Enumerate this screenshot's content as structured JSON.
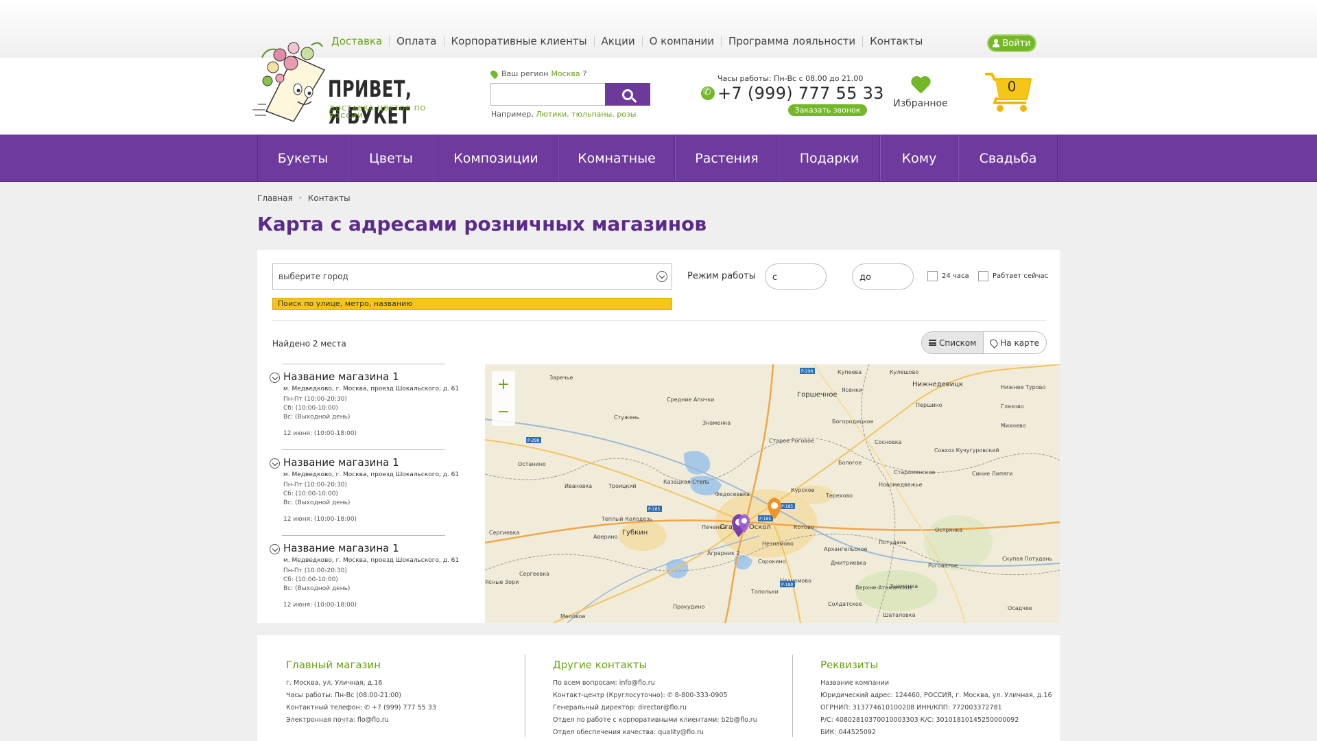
{
  "topnav": [
    "Доставка",
    "Оплата",
    "Корпоративные клиенты",
    "Акции",
    "О компании",
    "Программа лояльности",
    "Контакты"
  ],
  "login_label": "Войти",
  "logo": {
    "title": "ПРИВЕТ, Я БУКЕТ",
    "subtitle": "ДОСТАВКА ЦВЕТОВ ПО РОССИИ"
  },
  "region": {
    "label": "Ваш регион",
    "city": "Москва",
    "q": "?"
  },
  "search": {
    "hint_prefix": "Например,",
    "hint_examples": "Лютики, тюльпаны, розы"
  },
  "contact": {
    "hours": "Часы работы: Пн-Вс с 08.00 до 21.00",
    "phone": "+7 (999) 777 55 33",
    "callback": "Заказать звонок"
  },
  "favorites_label": "Избранное",
  "cart_count": "0",
  "mainnav": [
    "Букеты",
    "Цветы",
    "Композиции",
    "Комнатные",
    "Растения",
    "Подарки",
    "Кому",
    "Свадьба"
  ],
  "breadcrumb": {
    "home": "Главная",
    "sep": "›",
    "current": "Контакты"
  },
  "page_title": "Карта с адресами розничных магазинов",
  "filters": {
    "city_placeholder": "выберите город",
    "street_placeholder": "Поиск по улице, метро, названию",
    "mode_label": "Режим работы",
    "from": "с",
    "to": "до",
    "chk_24": "24 часа",
    "chk_now": "Рабтает сейчас"
  },
  "found": "Найдено 2 места",
  "view": {
    "list": "Списком",
    "map": "На карте"
  },
  "stores": [
    {
      "name": "Название магазина 1",
      "address": "м. Медведково, г. Москва, проезд Шокальского, д. 61",
      "weekdays": "Пн-Пт (10:00-20:30)",
      "sat": "Сб: (10:00-10:00)",
      "sun": "Вс: (Выходной день)",
      "date": "12 июня: (10:00-18:00)"
    },
    {
      "name": "Название магазина 1",
      "address": "м. Медведково, г. Москва, проезд Шокальского, д. 61",
      "weekdays": "Пн-Пт (10:00-20:30)",
      "sat": "Сб: (10:00-10:00)",
      "sun": "Вс: (Выходной день)",
      "date": "12 июня: (10:00-18:00)"
    },
    {
      "name": "Название магазина 1",
      "address": "м. Медведково, г. Москва, проезд Шокальского, д. 61",
      "weekdays": "Пн-Пт (10:00-20:30)",
      "sat": "Сб: (10:00-10:00)",
      "sun": "Вс: (Выходной день)",
      "date": "12 июня: (10:00-18:00)"
    }
  ],
  "map": {
    "zoom_in": "+",
    "zoom_out": "−",
    "places": [
      "Заречье",
      "Горшечное",
      "Нижнедевицк",
      "Купеева",
      "Ясенки",
      "Кулешово",
      "Першино",
      "Нижнее Турово",
      "Глазово",
      "Михнево",
      "Средние Апочки",
      "Стужень",
      "Знаменка",
      "Старое Роговое",
      "Богородицкое",
      "Сосновка",
      "Бологое",
      "Совхоз Кучугуровский",
      "Останино",
      "Казацкая Степь",
      "Федосеевка",
      "Курское",
      "Терехово",
      "Новомедвежье",
      "Староменское",
      "Синие Липяги",
      "Ивановка",
      "Троицкий",
      "Теплый Колодезь",
      "Губкин",
      "Печенка",
      "Котово",
      "Архангельское",
      "Потудань",
      "Острянка",
      "Сергиевка",
      "Старый Оскол",
      "Незнамово",
      "Аверино",
      "Аграрник 2",
      "Сорокино",
      "Дмитриевка",
      "Роговатое",
      "Скупая Потудань",
      "Верхне-Атаманское",
      "Солдатское",
      "Знаменка",
      "Осадчее",
      "Прокудино",
      "Топольки",
      "Шаталовка",
      "Меловое",
      "Ясные Зори",
      "Сергеевка",
      "Незнамово"
    ],
    "road_labels": [
      "Р-298",
      "Р-298",
      "Р-185",
      "Р-185",
      "Р-185",
      "Р-188"
    ]
  },
  "footer": {
    "main": {
      "title": "Главный магазин",
      "lines": [
        "г. Москва, ул. Уличная, д.16",
        "Часы работы: Пн-Вс (08:00-21:00)",
        "Контактный телефон:  ✆ +7 (999) 777 55 33",
        "Электронная почта: flo@flo.ru"
      ]
    },
    "other": {
      "title": "Другие контакты",
      "lines": [
        "По всем вопросам: info@flo.ru",
        "Контакт-центр (Круглосуточно):  ✆ 8-800-333-0905",
        "Генеральный директор: director@flo.ru",
        "Отдел по работе с корпоративными клиентами: b2b@flo.ru",
        "Отдел обеспечения качества: quality@flo.ru"
      ]
    },
    "req": {
      "title": "Реквизиты",
      "lines": [
        "Название компании",
        "Юридический адрес: 124460, РОССИЯ, г. Москва, ул. Уличная, д.16",
        "ОГРНИП: 313774610100208 ИНН/КПП: 772003372781",
        "Р/С: 40802810370010003303 К/С: 30101810145250000092",
        "БИК: 044525092"
      ]
    }
  },
  "colors": {
    "accent_purple": "#6e3a9e",
    "accent_green": "#74b82a",
    "highlight_yellow": "#f5c518"
  }
}
